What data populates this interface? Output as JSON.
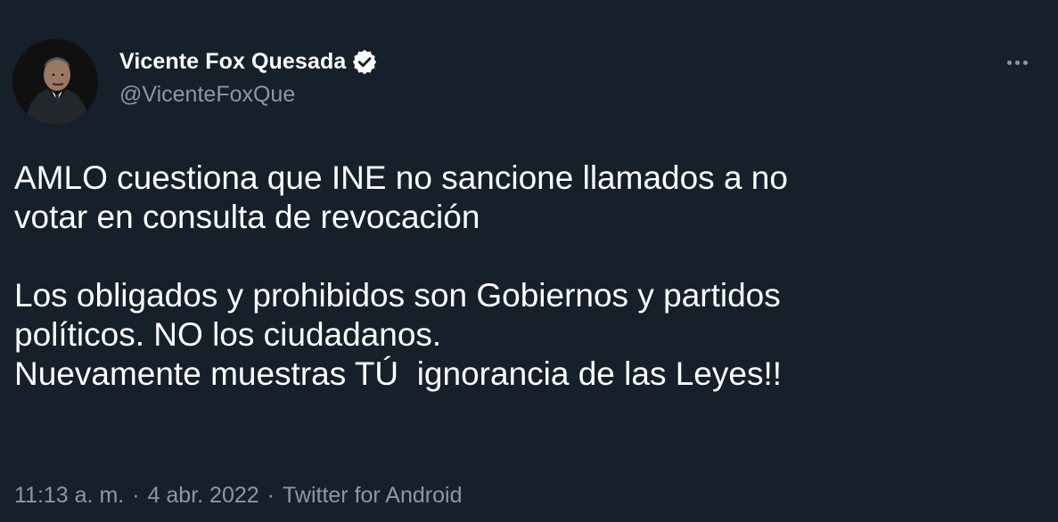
{
  "author": {
    "display_name": "Vicente Fox Quesada",
    "handle": "@VicenteFoxQue",
    "verified": true
  },
  "tweet": {
    "text": "AMLO cuestiona que INE no sancione llamados a no\nvotar en consulta de revocación\n\nLos obligados y prohibidos son Gobiernos y partidos\npolíticos. NO los ciudadanos.\nNuevamente muestras TÚ  ignorancia de las Leyes!!"
  },
  "meta": {
    "time": "11:13 a. m.",
    "separator_1": "·",
    "date": "4 abr. 2022",
    "separator_2": "·",
    "source": "Twitter for Android"
  },
  "icons": {
    "verified": "verified-badge-icon",
    "more": "more-options-icon"
  },
  "colors": {
    "background": "#15202b",
    "text": "#ffffff",
    "secondary": "#8b98a5"
  }
}
